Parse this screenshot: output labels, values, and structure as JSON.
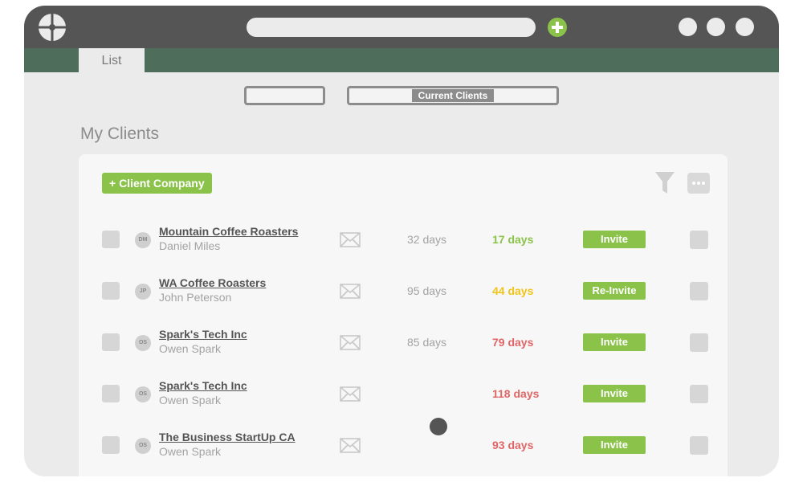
{
  "tabs": [
    {
      "label": "List"
    }
  ],
  "segmented": {
    "left_label": "",
    "current_label": "Current Clients"
  },
  "page": {
    "title": "My Clients"
  },
  "toolbar": {
    "add_label": "+ Client Company"
  },
  "icons": {
    "logo": "crosshair-logo-icon",
    "new_tab": "plus-circle-icon",
    "filter": "funnel-icon",
    "more": "more-dots-icon",
    "mail": "envelope-icon"
  },
  "colors": {
    "titlebar": "#555555",
    "tab_strip": "#4e6d5a",
    "accent_green": "#8bc34a",
    "days_green": "#8bc34a",
    "days_yellow": "#f0c419",
    "days_red": "#e06666"
  },
  "clients": [
    {
      "initials": "DM",
      "company": "Mountain Coffee Roasters",
      "contact": "Daniel Miles",
      "days_a": "32 days",
      "days_b": "17 days",
      "days_b_color": "#8bc34a",
      "action": "Invite"
    },
    {
      "initials": "JP",
      "company": "WA Coffee Roasters",
      "contact": "John Peterson",
      "days_a": "95 days",
      "days_b": "44 days",
      "days_b_color": "#f0c419",
      "action": "Re-Invite"
    },
    {
      "initials": "OS",
      "company": "Spark's Tech Inc",
      "contact": "Owen Spark",
      "days_a": "85 days",
      "days_b": "79 days",
      "days_b_color": "#e06666",
      "action": "Invite"
    },
    {
      "initials": "OS",
      "company": "Spark's Tech Inc",
      "contact": "Owen Spark",
      "days_a": "",
      "days_b": "118 days",
      "days_b_color": "#e06666",
      "action": "Invite"
    },
    {
      "initials": "OS",
      "company": "The Business StartUp CA",
      "contact": "Owen Spark",
      "days_a": "",
      "days_b": "93 days",
      "days_b_color": "#e06666",
      "action": "Invite"
    }
  ]
}
